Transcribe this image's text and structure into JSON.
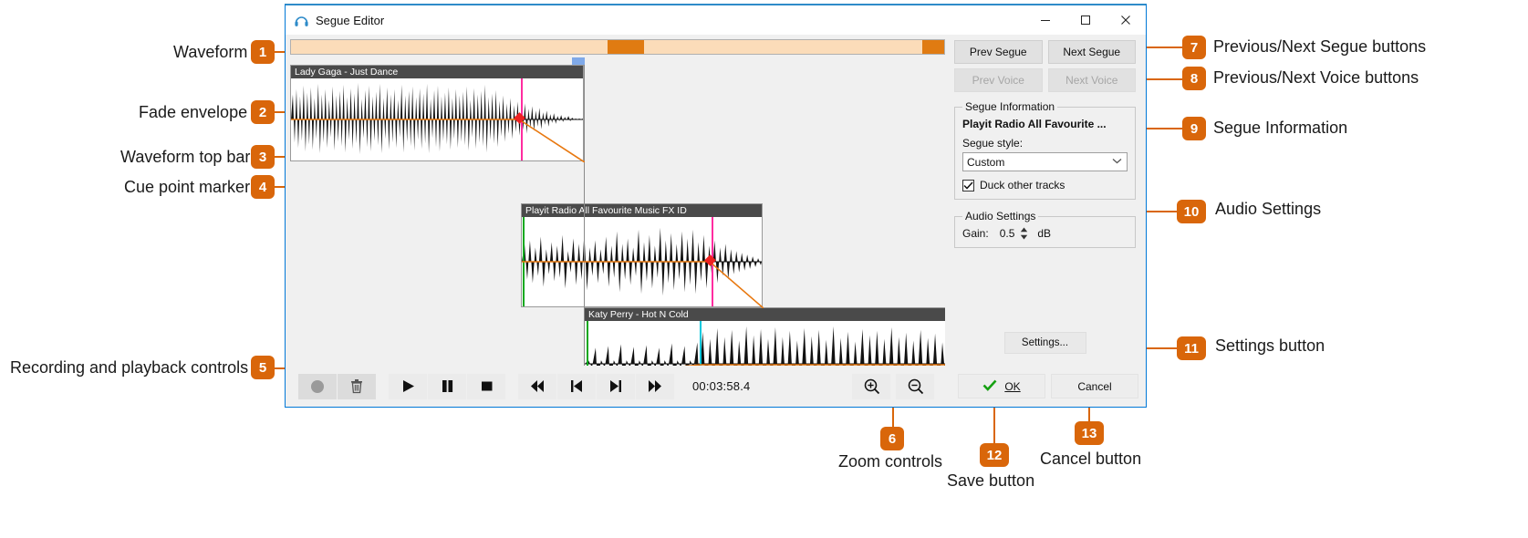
{
  "window": {
    "title": "Segue Editor",
    "icon": "headphones-icon",
    "minimize_label": "—",
    "maximize_label": "□",
    "close_label": "✕"
  },
  "tracks": [
    {
      "title": "Lady Gaga - Just Dance"
    },
    {
      "title": "Playit Radio All Favourite Music FX ID"
    },
    {
      "title": "Katy Perry - Hot N Cold"
    }
  ],
  "right_panel": {
    "prev_segue_label": "Prev Segue",
    "next_segue_label": "Next Segue",
    "prev_voice_label": "Prev Voice",
    "next_voice_label": "Next Voice",
    "segue_information": {
      "legend": "Segue Information",
      "segue_name": "Playit Radio All Favourite ...",
      "segue_style_label": "Segue style:",
      "segue_style_value": "Custom",
      "segue_style_options": [
        "Custom"
      ],
      "duck_label": "Duck other tracks",
      "duck_checked": true
    },
    "audio_settings": {
      "legend": "Audio Settings",
      "gain_label": "Gain:",
      "gain_value": "0.5",
      "gain_unit": "dB"
    },
    "settings_button_label": "Settings..."
  },
  "toolbar": {
    "record_icon": "record-icon",
    "delete_icon": "trash-icon",
    "play_icon": "play-icon",
    "pause_icon": "pause-icon",
    "stop_icon": "stop-icon",
    "rewind_icon": "rewind-icon",
    "prev_icon": "skip-previous-icon",
    "next_icon": "skip-next-icon",
    "fastforward_icon": "fast-forward-icon",
    "timecode": "00:03:58.4",
    "zoom_in_icon": "zoom-in-icon",
    "zoom_out_icon": "zoom-out-icon",
    "ok_label": "OK",
    "ok_check_icon": "check-icon",
    "cancel_label": "Cancel"
  },
  "annotations": [
    {
      "n": "1",
      "label": "Waveform"
    },
    {
      "n": "2",
      "label": "Fade envelope"
    },
    {
      "n": "3",
      "label": "Waveform top bar"
    },
    {
      "n": "4",
      "label": "Cue point marker"
    },
    {
      "n": "5",
      "label": "Recording and playback controls"
    },
    {
      "n": "6",
      "label": "Zoom controls"
    },
    {
      "n": "7",
      "label": "Previous/Next Segue buttons"
    },
    {
      "n": "8",
      "label": "Previous/Next Voice buttons"
    },
    {
      "n": "9",
      "label": "Segue Information"
    },
    {
      "n": "10",
      "label": "Audio Settings"
    },
    {
      "n": "11",
      "label": "Settings button"
    },
    {
      "n": "12",
      "label": "Save button"
    },
    {
      "n": "13",
      "label": "Cancel button"
    }
  ],
  "colors": {
    "accent": "#d9660a",
    "window_border": "#0078d7",
    "overview_bg": "#fbdcb9",
    "overview_seg": "#e07b12",
    "envelope": "#e8780f",
    "cue_marker": "#ee2222",
    "marker_pink": "#ff2ca0",
    "marker_green": "#0aa81e",
    "marker_cyan": "#00c8dd"
  }
}
